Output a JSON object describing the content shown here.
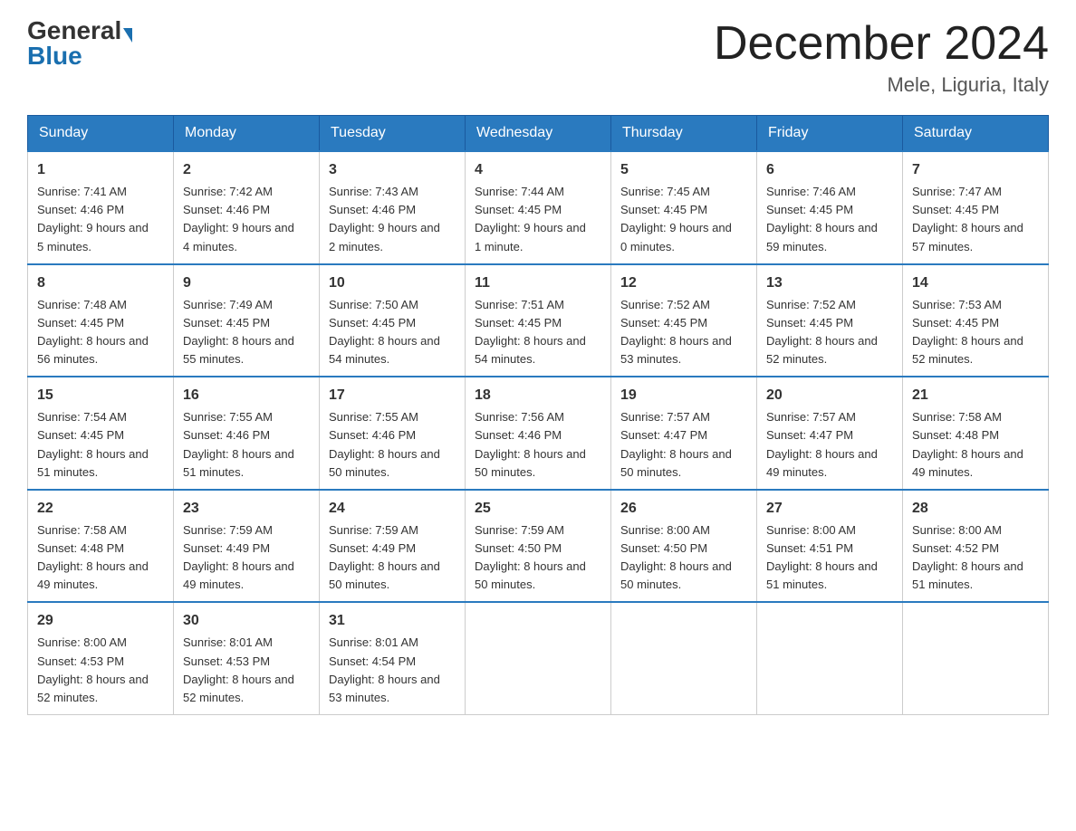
{
  "header": {
    "logo_general": "General",
    "logo_blue": "Blue",
    "month_title": "December 2024",
    "location": "Mele, Liguria, Italy"
  },
  "weekdays": [
    "Sunday",
    "Monday",
    "Tuesday",
    "Wednesday",
    "Thursday",
    "Friday",
    "Saturday"
  ],
  "weeks": [
    [
      {
        "day": "1",
        "sunrise": "7:41 AM",
        "sunset": "4:46 PM",
        "daylight": "9 hours and 5 minutes."
      },
      {
        "day": "2",
        "sunrise": "7:42 AM",
        "sunset": "4:46 PM",
        "daylight": "9 hours and 4 minutes."
      },
      {
        "day": "3",
        "sunrise": "7:43 AM",
        "sunset": "4:46 PM",
        "daylight": "9 hours and 2 minutes."
      },
      {
        "day": "4",
        "sunrise": "7:44 AM",
        "sunset": "4:45 PM",
        "daylight": "9 hours and 1 minute."
      },
      {
        "day": "5",
        "sunrise": "7:45 AM",
        "sunset": "4:45 PM",
        "daylight": "9 hours and 0 minutes."
      },
      {
        "day": "6",
        "sunrise": "7:46 AM",
        "sunset": "4:45 PM",
        "daylight": "8 hours and 59 minutes."
      },
      {
        "day": "7",
        "sunrise": "7:47 AM",
        "sunset": "4:45 PM",
        "daylight": "8 hours and 57 minutes."
      }
    ],
    [
      {
        "day": "8",
        "sunrise": "7:48 AM",
        "sunset": "4:45 PM",
        "daylight": "8 hours and 56 minutes."
      },
      {
        "day": "9",
        "sunrise": "7:49 AM",
        "sunset": "4:45 PM",
        "daylight": "8 hours and 55 minutes."
      },
      {
        "day": "10",
        "sunrise": "7:50 AM",
        "sunset": "4:45 PM",
        "daylight": "8 hours and 54 minutes."
      },
      {
        "day": "11",
        "sunrise": "7:51 AM",
        "sunset": "4:45 PM",
        "daylight": "8 hours and 54 minutes."
      },
      {
        "day": "12",
        "sunrise": "7:52 AM",
        "sunset": "4:45 PM",
        "daylight": "8 hours and 53 minutes."
      },
      {
        "day": "13",
        "sunrise": "7:52 AM",
        "sunset": "4:45 PM",
        "daylight": "8 hours and 52 minutes."
      },
      {
        "day": "14",
        "sunrise": "7:53 AM",
        "sunset": "4:45 PM",
        "daylight": "8 hours and 52 minutes."
      }
    ],
    [
      {
        "day": "15",
        "sunrise": "7:54 AM",
        "sunset": "4:45 PM",
        "daylight": "8 hours and 51 minutes."
      },
      {
        "day": "16",
        "sunrise": "7:55 AM",
        "sunset": "4:46 PM",
        "daylight": "8 hours and 51 minutes."
      },
      {
        "day": "17",
        "sunrise": "7:55 AM",
        "sunset": "4:46 PM",
        "daylight": "8 hours and 50 minutes."
      },
      {
        "day": "18",
        "sunrise": "7:56 AM",
        "sunset": "4:46 PM",
        "daylight": "8 hours and 50 minutes."
      },
      {
        "day": "19",
        "sunrise": "7:57 AM",
        "sunset": "4:47 PM",
        "daylight": "8 hours and 50 minutes."
      },
      {
        "day": "20",
        "sunrise": "7:57 AM",
        "sunset": "4:47 PM",
        "daylight": "8 hours and 49 minutes."
      },
      {
        "day": "21",
        "sunrise": "7:58 AM",
        "sunset": "4:48 PM",
        "daylight": "8 hours and 49 minutes."
      }
    ],
    [
      {
        "day": "22",
        "sunrise": "7:58 AM",
        "sunset": "4:48 PM",
        "daylight": "8 hours and 49 minutes."
      },
      {
        "day": "23",
        "sunrise": "7:59 AM",
        "sunset": "4:49 PM",
        "daylight": "8 hours and 49 minutes."
      },
      {
        "day": "24",
        "sunrise": "7:59 AM",
        "sunset": "4:49 PM",
        "daylight": "8 hours and 50 minutes."
      },
      {
        "day": "25",
        "sunrise": "7:59 AM",
        "sunset": "4:50 PM",
        "daylight": "8 hours and 50 minutes."
      },
      {
        "day": "26",
        "sunrise": "8:00 AM",
        "sunset": "4:50 PM",
        "daylight": "8 hours and 50 minutes."
      },
      {
        "day": "27",
        "sunrise": "8:00 AM",
        "sunset": "4:51 PM",
        "daylight": "8 hours and 51 minutes."
      },
      {
        "day": "28",
        "sunrise": "8:00 AM",
        "sunset": "4:52 PM",
        "daylight": "8 hours and 51 minutes."
      }
    ],
    [
      {
        "day": "29",
        "sunrise": "8:00 AM",
        "sunset": "4:53 PM",
        "daylight": "8 hours and 52 minutes."
      },
      {
        "day": "30",
        "sunrise": "8:01 AM",
        "sunset": "4:53 PM",
        "daylight": "8 hours and 52 minutes."
      },
      {
        "day": "31",
        "sunrise": "8:01 AM",
        "sunset": "4:54 PM",
        "daylight": "8 hours and 53 minutes."
      },
      null,
      null,
      null,
      null
    ]
  ],
  "labels": {
    "sunrise": "Sunrise:",
    "sunset": "Sunset:",
    "daylight": "Daylight:"
  }
}
